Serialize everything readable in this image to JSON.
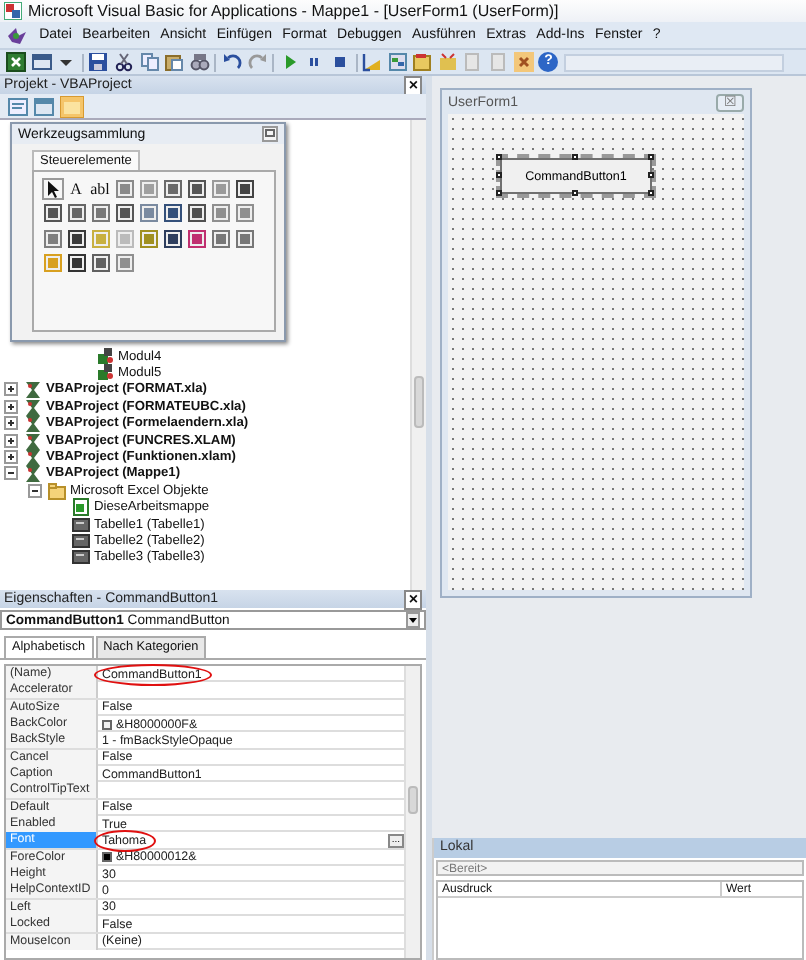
{
  "window": {
    "title": "Microsoft Visual Basic for Applications - Mappe1 - [UserForm1 (UserForm)]"
  },
  "menu": [
    "Datei",
    "Bearbeiten",
    "Ansicht",
    "Einfügen",
    "Format",
    "Debuggen",
    "Ausführen",
    "Extras",
    "Add-Ins",
    "Fenster",
    "?"
  ],
  "toolbar": {
    "help_glyph": "?"
  },
  "project": {
    "title": "Projekt - VBAProject",
    "close": "×",
    "tree": [
      {
        "label": "Modul4",
        "kind": "module"
      },
      {
        "label": "Modul5",
        "kind": "module"
      },
      {
        "label": "VBAProject (FORMAT.xla)",
        "kind": "project",
        "expanded": false
      },
      {
        "label": "VBAProject (FORMATEUBC.xla)",
        "kind": "project",
        "expanded": false
      },
      {
        "label": "VBAProject (Formelaendern.xla)",
        "kind": "project",
        "expanded": false
      },
      {
        "label": "VBAProject (FUNCRES.XLAM)",
        "kind": "project",
        "expanded": false
      },
      {
        "label": "VBAProject (Funktionen.xlam)",
        "kind": "project",
        "expanded": false
      },
      {
        "label": "VBAProject (Mappe1)",
        "kind": "project",
        "expanded": true,
        "children": [
          {
            "label": "Microsoft Excel Objekte",
            "kind": "folder",
            "expanded": true,
            "children": [
              {
                "label": "DieseArbeitsmappe",
                "kind": "workbook"
              },
              {
                "label": "Tabelle1 (Tabelle1)",
                "kind": "sheet"
              },
              {
                "label": "Tabelle2 (Tabelle2)",
                "kind": "sheet"
              },
              {
                "label": "Tabelle3 (Tabelle3)",
                "kind": "sheet"
              }
            ]
          }
        ]
      }
    ]
  },
  "toolbox": {
    "title": "Werkzeugsammlung",
    "tabs": [
      {
        "label": "Steuerelemente",
        "selected": true
      }
    ],
    "tools": [
      {
        "kind": "pointer"
      },
      {
        "kind": "glyph",
        "text": "A"
      },
      {
        "kind": "glyph",
        "text": "abl"
      },
      {
        "kind": "tile",
        "color": "#8a8a8a"
      },
      {
        "kind": "tile",
        "color": "#a0a0a0"
      },
      {
        "kind": "tile",
        "color": "#6a6a6a"
      },
      {
        "kind": "tile",
        "color": "#555555"
      },
      {
        "kind": "tile",
        "color": "#9a9a9a"
      },
      {
        "kind": "tile",
        "color": "#444444"
      },
      {
        "kind": "tile",
        "color": "#555555"
      },
      {
        "kind": "tile",
        "color": "#666666"
      },
      {
        "kind": "tile",
        "color": "#777777"
      },
      {
        "kind": "tile",
        "color": "#555555"
      },
      {
        "kind": "tile",
        "color": "#7a8aa0"
      },
      {
        "kind": "tile",
        "color": "#34507a"
      },
      {
        "kind": "tile",
        "color": "#505050"
      },
      {
        "kind": "tile",
        "color": "#8f8f8f"
      },
      {
        "kind": "tile",
        "color": "#8f8f8f"
      },
      {
        "kind": "tile",
        "color": "#7f7f7f"
      },
      {
        "kind": "tile",
        "color": "#3a3a3a"
      },
      {
        "kind": "tile",
        "color": "#c8b040"
      },
      {
        "kind": "tile",
        "color": "#bbbbbb"
      },
      {
        "kind": "tile",
        "color": "#a09020"
      },
      {
        "kind": "tile",
        "color": "#2e3e5e"
      },
      {
        "kind": "tile",
        "color": "#c03070"
      },
      {
        "kind": "tile",
        "color": "#777777"
      },
      {
        "kind": "tile",
        "color": "#777777"
      },
      {
        "kind": "tile",
        "color": "#d8a020"
      },
      {
        "kind": "tile",
        "color": "#333333"
      },
      {
        "kind": "tile",
        "color": "#606060"
      },
      {
        "kind": "tile",
        "color": "#8f8f8f"
      }
    ]
  },
  "properties": {
    "title": "Eigenschaften - CommandButton1",
    "close": "×",
    "object_name": "CommandButton1",
    "object_type": "CommandButton",
    "tabs": [
      {
        "label": "Alphabetisch",
        "selected": true
      },
      {
        "label": "Nach Kategorien",
        "selected": false
      }
    ],
    "rows": [
      {
        "name": "(Name)",
        "value": "CommandButton1",
        "selected": false,
        "circled": true
      },
      {
        "name": "Accelerator",
        "selected": false
      },
      {
        "name": "AutoSize",
        "value": "False",
        "selected": false
      },
      {
        "name": "BackColor",
        "value": "&H8000000F&",
        "color": "#f0f0f0",
        "selected": false
      },
      {
        "name": "BackStyle",
        "value": "1 - fmBackStyleOpaque",
        "selected": false
      },
      {
        "name": "Cancel",
        "value": "False",
        "selected": false
      },
      {
        "name": "Caption",
        "value": "CommandButton1",
        "selected": false
      },
      {
        "name": "ControlTipText",
        "selected": false
      },
      {
        "name": "Default",
        "value": "False",
        "selected": false
      },
      {
        "name": "Enabled",
        "value": "True",
        "selected": false
      },
      {
        "name": "Font",
        "value": "Tahoma",
        "button": "...",
        "selected": true,
        "circled": true
      },
      {
        "name": "ForeColor",
        "value": "&H80000012&",
        "color": "#000000",
        "selected": false
      },
      {
        "name": "Height",
        "value": "30",
        "selected": false
      },
      {
        "name": "HelpContextID",
        "value": "0",
        "selected": false
      },
      {
        "name": "Left",
        "value": "30",
        "selected": false
      },
      {
        "name": "Locked",
        "value": "False",
        "selected": false
      },
      {
        "name": "MouseIcon",
        "value": "(Keine)",
        "selected": false
      }
    ]
  },
  "userform": {
    "title": "UserForm1",
    "close": "☒",
    "button_caption": "CommandButton1"
  },
  "locals": {
    "title": "Lokal",
    "status": "<Bereit>",
    "columns": [
      "Ausdruck",
      "Wert"
    ]
  }
}
